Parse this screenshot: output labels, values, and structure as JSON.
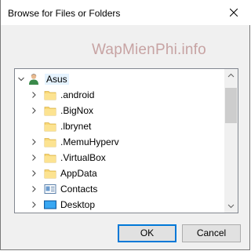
{
  "window": {
    "title": "Browse for Files or Folders"
  },
  "watermark": "WapMienPhi.info",
  "tree": {
    "root": {
      "label": "Asus",
      "icon": "user-folder-icon",
      "expanded": true
    },
    "items": [
      {
        "label": ".android",
        "icon": "folder-icon",
        "expandable": true
      },
      {
        "label": ".BigNox",
        "icon": "folder-icon",
        "expandable": true
      },
      {
        "label": ".lbrynet",
        "icon": "folder-icon",
        "expandable": false
      },
      {
        "label": ".MemuHyperv",
        "icon": "folder-icon",
        "expandable": true
      },
      {
        "label": ".VirtualBox",
        "icon": "folder-icon",
        "expandable": true
      },
      {
        "label": "AppData",
        "icon": "folder-icon",
        "expandable": true
      },
      {
        "label": "Contacts",
        "icon": "contacts-folder-icon",
        "expandable": true
      },
      {
        "label": "Desktop",
        "icon": "desktop-folder-icon",
        "expandable": true
      }
    ]
  },
  "buttons": {
    "ok": "OK",
    "cancel": "Cancel"
  },
  "colors": {
    "accent": "#0078d7",
    "folder": "#f8d775",
    "selection": "#e5f3ff"
  }
}
